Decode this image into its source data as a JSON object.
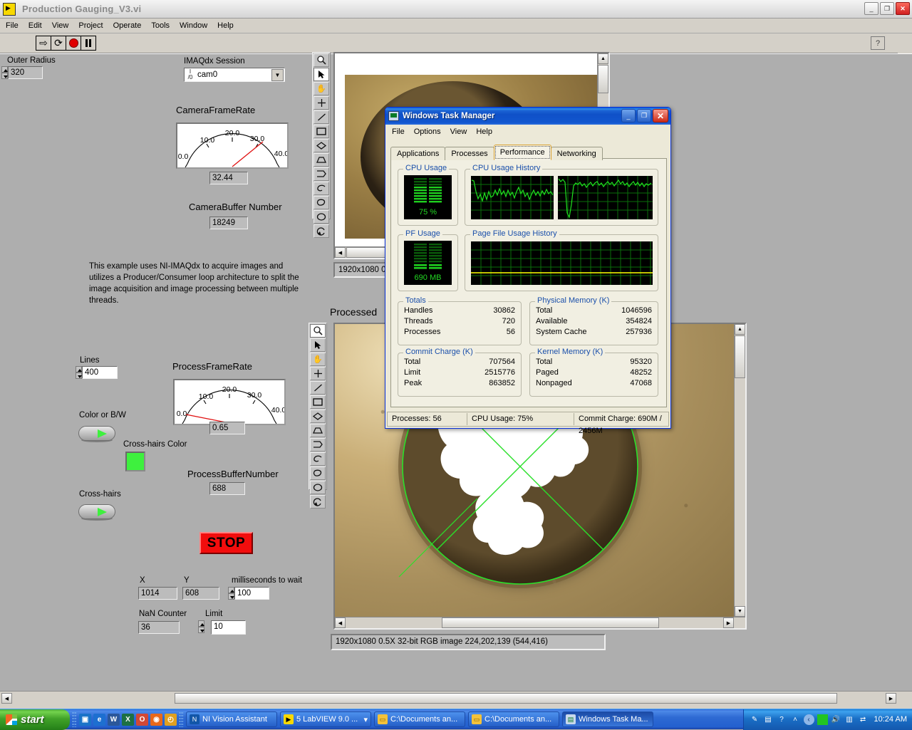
{
  "labview": {
    "title": "Production Gauging_V3.vi",
    "window_icon": "labview-vi-icon",
    "window_buttons": [
      "minimize",
      "maximize",
      "close"
    ],
    "menu": [
      "File",
      "Edit",
      "View",
      "Project",
      "Operate",
      "Tools",
      "Window",
      "Help"
    ],
    "toolbar": {
      "run": "run-arrow-icon",
      "run_continuous": "run-continuously-icon",
      "abort": "abort-execution-icon",
      "pause": "pause-icon",
      "help": "?"
    },
    "controls": {
      "outer_radius_label": "Outer Radius",
      "outer_radius_value": "320",
      "imaqdx_label": "IMAQdx Session",
      "imaqdx_value": "cam0",
      "camera_frame_rate_label": "CameraFrameRate",
      "camera_frame_rate_value": "32.44",
      "camera_buffer_label": "CameraBuffer Number",
      "camera_buffer_value": "18249",
      "lines_label": "Lines",
      "lines_value": "400",
      "color_bw_label": "Color or B/W",
      "color_bw_state": "on",
      "crosshairs_color_label": "Cross-hairs Color",
      "crosshairs_color_value": "#3ef03e",
      "crosshairs_label": "Cross-hairs",
      "crosshairs_state": "on",
      "process_frame_rate_label": "ProcessFrameRate",
      "process_frame_rate_value": "0.65",
      "process_buffer_label": "ProcessBufferNumber",
      "process_buffer_value": "688",
      "stop_label": "STOP",
      "x_label": "X",
      "x_value": "1014",
      "y_label": "Y",
      "y_value": "608",
      "ms_wait_label": "milliseconds to wait",
      "ms_wait_value": "100",
      "nan_counter_label": "NaN Counter",
      "nan_counter_value": "36",
      "limit_label": "Limit",
      "limit_value": "10"
    },
    "description": "This example uses NI-IMAQdx to acquire images and utilizes a Producer/Consumer loop architecture to split the image acquisition and image processing between multiple threads.",
    "gauge_ticks": [
      "0.0",
      "10.0",
      "20.0",
      "30.0",
      "40.0"
    ],
    "image_viewers": {
      "acquired_status": "1920x1080 0",
      "processed_label": "Processed",
      "processed_status": "1920x1080 0.5X 32-bit RGB image 224,202,139   (544,416)"
    },
    "palette_tools": [
      "magnifier-icon",
      "arrow-select-icon",
      "pan-hand-icon",
      "crosshair-point-icon",
      "line-icon",
      "rectangle-icon",
      "rotated-rectangle-icon",
      "polygon-icon",
      "broken-line-icon",
      "freehand-icon",
      "annulus-icon",
      "oval-icon",
      "rotate-icon"
    ]
  },
  "taskmgr": {
    "title": "Windows Task Manager",
    "menu": [
      "File",
      "Options",
      "View",
      "Help"
    ],
    "tabs": [
      "Applications",
      "Processes",
      "Performance",
      "Networking"
    ],
    "active_tab": "Performance",
    "cpu_usage_label": "CPU Usage",
    "cpu_usage_value": "75 %",
    "cpu_history_label": "CPU Usage History",
    "pf_usage_label": "PF Usage",
    "pf_usage_value": "690 MB",
    "pf_history_label": "Page File Usage History",
    "groups": [
      {
        "name": "Totals",
        "rows": [
          {
            "key": "Handles",
            "value": "30862"
          },
          {
            "key": "Threads",
            "value": "720"
          },
          {
            "key": "Processes",
            "value": "56"
          }
        ]
      },
      {
        "name": "Physical Memory (K)",
        "rows": [
          {
            "key": "Total",
            "value": "1046596"
          },
          {
            "key": "Available",
            "value": "354824"
          },
          {
            "key": "System Cache",
            "value": "257936"
          }
        ]
      },
      {
        "name": "Commit Charge (K)",
        "rows": [
          {
            "key": "Total",
            "value": "707564"
          },
          {
            "key": "Limit",
            "value": "2515776"
          },
          {
            "key": "Peak",
            "value": "863852"
          }
        ]
      },
      {
        "name": "Kernel Memory (K)",
        "rows": [
          {
            "key": "Total",
            "value": "95320"
          },
          {
            "key": "Paged",
            "value": "48252"
          },
          {
            "key": "Nonpaged",
            "value": "47068"
          }
        ]
      }
    ],
    "status": [
      "Processes: 56",
      "CPU Usage: 75%",
      "Commit Charge: 690M / 2456M"
    ],
    "colors": {
      "graph_line": "#00ff00",
      "grid": "#008000",
      "pf_line": "#ffff00",
      "group_label": "#1a4faa"
    }
  },
  "taskbar": {
    "start_label": "start",
    "quick_launch": [
      "show-desktop-icon",
      "internet-explorer-icon",
      "word-icon",
      "excel-icon",
      "outlook-icon",
      "firefox-icon",
      "clock-icon"
    ],
    "items": [
      {
        "label": "NI Vision Assistant",
        "icon": "ni-vision-icon",
        "active": false
      },
      {
        "label": "5 LabVIEW 9.0 ...",
        "icon": "labview-icon",
        "active": false,
        "group": true
      },
      {
        "label": "C:\\Documents an...",
        "icon": "folder-icon",
        "active": false
      },
      {
        "label": "C:\\Documents an...",
        "icon": "folder-icon",
        "active": false
      },
      {
        "label": "Windows Task Ma...",
        "icon": "taskmgr-icon",
        "active": true
      }
    ],
    "tray_icons": [
      "pen-icon",
      "tablet-icon",
      "help-icon",
      "chevron-up-icon",
      "volume-icon",
      "network-icon",
      "shield-icon",
      "display-icon"
    ],
    "clock": "10:24 AM"
  }
}
